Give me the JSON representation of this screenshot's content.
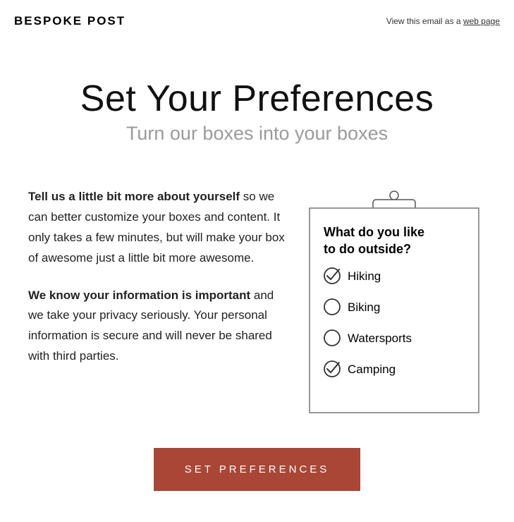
{
  "header": {
    "brand": "BESPOKE POST",
    "view_email_prefix": "View this email as a ",
    "view_email_link": "web page"
  },
  "hero": {
    "title": "Set Your Preferences",
    "subtitle": "Turn our boxes into your boxes"
  },
  "body": {
    "p1_strong": "Tell us a little bit more about yourself",
    "p1_rest": " so we can better customize your boxes and content. It only takes a few minutes, but will make your box of awesome just a little bit more awesome.",
    "p2_strong": "We know your information is important",
    "p2_rest": " and we take your privacy seriously. Your personal information is secure and will never be shared with third parties."
  },
  "clipboard": {
    "question_line1": "What do you like",
    "question_line2": "to do outside?",
    "options": [
      {
        "label": "Hiking",
        "checked": true
      },
      {
        "label": "Biking",
        "checked": false
      },
      {
        "label": "Watersports",
        "checked": false
      },
      {
        "label": "Camping",
        "checked": true
      }
    ]
  },
  "cta": {
    "label": "SET PREFERENCES"
  }
}
